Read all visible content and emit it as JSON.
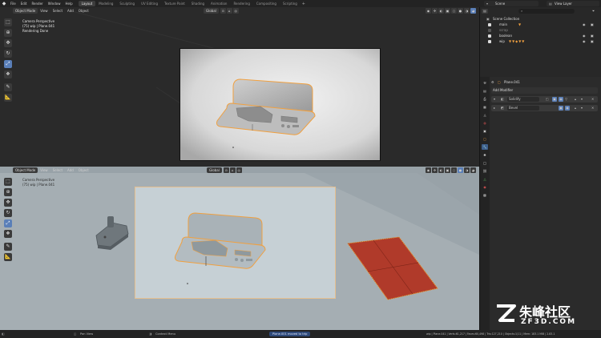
{
  "topbar": {
    "logo": "◆",
    "menus": [
      "File",
      "Edit",
      "Render",
      "Window",
      "Help"
    ],
    "workspaces": [
      "Layout",
      "Modeling",
      "Sculpting",
      "UV Editing",
      "Texture Paint",
      "Shading",
      "Animation",
      "Rendering",
      "Compositing",
      "Scripting"
    ],
    "active_workspace": "Layout",
    "add_workspace": "+",
    "scene": "Scene",
    "view_layer": "View Layer"
  },
  "viewport_top": {
    "mode": "Object Mode",
    "menus": [
      "View",
      "Select",
      "Add",
      "Object"
    ],
    "transform": "Global",
    "overlay_lines": [
      "Camera Perspective",
      "(75) wip | Plane.041",
      "Rendering Done"
    ]
  },
  "viewport_bottom": {
    "mode": "Object Mode",
    "menus": [
      "View",
      "Select",
      "Add",
      "Object"
    ],
    "transform": "Global",
    "overlay_lines": [
      "Camera Perspective",
      "(75) wip | Plane.041"
    ]
  },
  "outliner": {
    "search_placeholder": "",
    "root": "Scene Collection",
    "items": [
      {
        "label": "main",
        "checked": true
      },
      {
        "label": "scrap",
        "checked": false
      },
      {
        "label": "boolean",
        "checked": true
      },
      {
        "label": "wip",
        "checked": true
      }
    ]
  },
  "properties": {
    "object_name": "Plane.041",
    "add_modifier": "Add Modifier",
    "modifiers": [
      {
        "name": "Solidify"
      },
      {
        "name": "Bevel"
      }
    ]
  },
  "statusbar": {
    "pan_view": "Pan View",
    "context_menu": "Context Menu",
    "message": "Plane.001 moved to trip",
    "stats": "wip | Plane.041 | Verts:61,217 | Faces:60,498 | Tris:127,210 | Objects:1/11 | Mem: 183.1 MiB | 2.83.1"
  },
  "watermark": {
    "chinese": "朱峰社区",
    "site": "ZF3D.COM"
  },
  "colors": {
    "accent": "#5a7fb8",
    "selection_orange": "#f0a040",
    "cloth_red": "#b03a2a"
  }
}
